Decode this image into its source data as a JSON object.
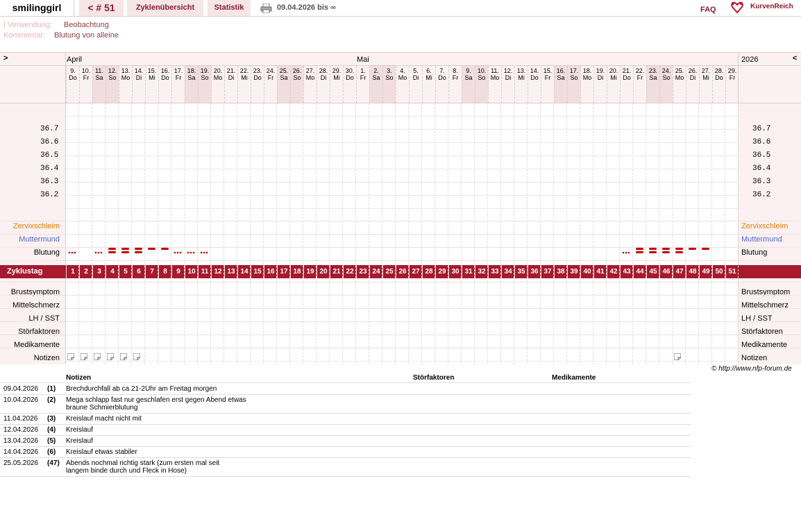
{
  "topbar": {
    "user": "smilinggirl",
    "cycle": "< # 51",
    "overview": "Zyklenübersicht",
    "stats": "Statistik",
    "range": "09.04.2026 bis ∞",
    "faq": "FAQ",
    "brand": "KurvenReich",
    "print_icon": "printer-icon",
    "logo_icon": "heart-logo-icon"
  },
  "meta": {
    "use_label": "| Verwendung:",
    "use_value": "Beobachtung",
    "comment_label": "Kommentar:",
    "comment_value": "Blutung von alleine"
  },
  "chart": {
    "nav_left": ">",
    "nav_right": "<",
    "year": "2026",
    "month_april": "April",
    "month_may": "Mai",
    "days": [
      [
        "9.",
        "Do"
      ],
      [
        "10.",
        "Fr"
      ],
      [
        "11.",
        "Sa"
      ],
      [
        "12.",
        "So"
      ],
      [
        "13.",
        "Mo"
      ],
      [
        "14.",
        "Di"
      ],
      [
        "15.",
        "Mi"
      ],
      [
        "16.",
        "Do"
      ],
      [
        "17.",
        "Fr"
      ],
      [
        "18.",
        "Sa"
      ],
      [
        "19.",
        "So"
      ],
      [
        "20.",
        "Mo"
      ],
      [
        "21.",
        "Di"
      ],
      [
        "22.",
        "Mi"
      ],
      [
        "23.",
        "Do"
      ],
      [
        "24.",
        "Fr"
      ],
      [
        "25.",
        "Sa"
      ],
      [
        "26.",
        "So"
      ],
      [
        "27.",
        "Mo"
      ],
      [
        "28.",
        "Di"
      ],
      [
        "29.",
        "Mi"
      ],
      [
        "30.",
        "Do"
      ],
      [
        "1.",
        "Fr"
      ],
      [
        "2.",
        "Sa"
      ],
      [
        "3.",
        "So"
      ],
      [
        "4.",
        "Mo"
      ],
      [
        "5.",
        "Di"
      ],
      [
        "6.",
        "Mi"
      ],
      [
        "7.",
        "Do"
      ],
      [
        "8.",
        "Fr"
      ],
      [
        "9.",
        "Sa"
      ],
      [
        "10.",
        "So"
      ],
      [
        "11.",
        "Mo"
      ],
      [
        "12.",
        "Di"
      ],
      [
        "13.",
        "Mi"
      ],
      [
        "14.",
        "Do"
      ],
      [
        "15.",
        "Fr"
      ],
      [
        "16.",
        "Sa"
      ],
      [
        "17.",
        "So"
      ],
      [
        "18.",
        "Mo"
      ],
      [
        "19.",
        "Di"
      ],
      [
        "20.",
        "Mi"
      ],
      [
        "21.",
        "Do"
      ],
      [
        "22.",
        "Fr"
      ],
      [
        "23.",
        "Sa"
      ],
      [
        "24.",
        "So"
      ],
      [
        "25.",
        "Mo"
      ],
      [
        "26.",
        "Di"
      ],
      [
        "27.",
        "Mi"
      ],
      [
        "28.",
        "Do"
      ],
      [
        "29.",
        "Fr"
      ]
    ],
    "temp_ticks": [
      "36.7",
      "36.6",
      "36.5",
      "36.4",
      "36.3",
      "36.2"
    ],
    "rows": {
      "zervix": "Zervixschleim",
      "muttermund": "Muttermund",
      "blutung": "Blutung",
      "zyklustag": "Zyklustag",
      "brust": "Brustsymptom",
      "mittel": "Mittelschmerz",
      "lh": "LH / SST",
      "stoer": "Störfaktoren",
      "medi": "Medikamente",
      "notizen": "Notizen"
    },
    "bleeding": {
      "1": "light",
      "3": "light",
      "4": "heavy",
      "5": "heavy",
      "6": "heavy",
      "7": "medium",
      "8": "medium",
      "9": "light",
      "10": "light",
      "11": "light",
      "43": "light",
      "44": "heavy",
      "45": "heavy",
      "46": "heavy",
      "47": "heavy",
      "48": "medium",
      "49": "medium"
    },
    "notes_days": [
      1,
      2,
      3,
      4,
      5,
      6,
      47
    ],
    "copyright": "© http://www.nfp-forum.de",
    "colors": {
      "accent": "#a6192e",
      "zervix": "#e07b00",
      "muttermund": "#5566cc",
      "bleed": "#c00000"
    }
  },
  "notes": {
    "headers": {
      "notizen": "Notizen",
      "stoer": "Störfaktoren",
      "medi": "Medikamente"
    },
    "rows": [
      {
        "date": "09.04.2026",
        "day": "(1)",
        "text": "Brechdurchfall ab ca 21-2Uhr am Freitag morgen"
      },
      {
        "date": "10.04.2026",
        "day": "(2)",
        "text": "Mega schlapp fast nur geschlafen erst gegen Abend etwas\nbraune Schmierblutung"
      },
      {
        "date": "11.04.2026",
        "day": "(3)",
        "text": "Kreislauf macht nicht mit"
      },
      {
        "date": "12.04.2026",
        "day": "(4)",
        "text": "Kreislauf"
      },
      {
        "date": "13.04.2026",
        "day": "(5)",
        "text": "Kreislauf"
      },
      {
        "date": "14.04.2026",
        "day": "(6)",
        "text": "Kreislauf etwas stabiler"
      },
      {
        "date": "25.05.2026",
        "day": "(47)",
        "text": "Abends nochmal richtig stark (zum ersten mal seit\nlangem binde durch und Fleck in Hose)"
      }
    ]
  }
}
